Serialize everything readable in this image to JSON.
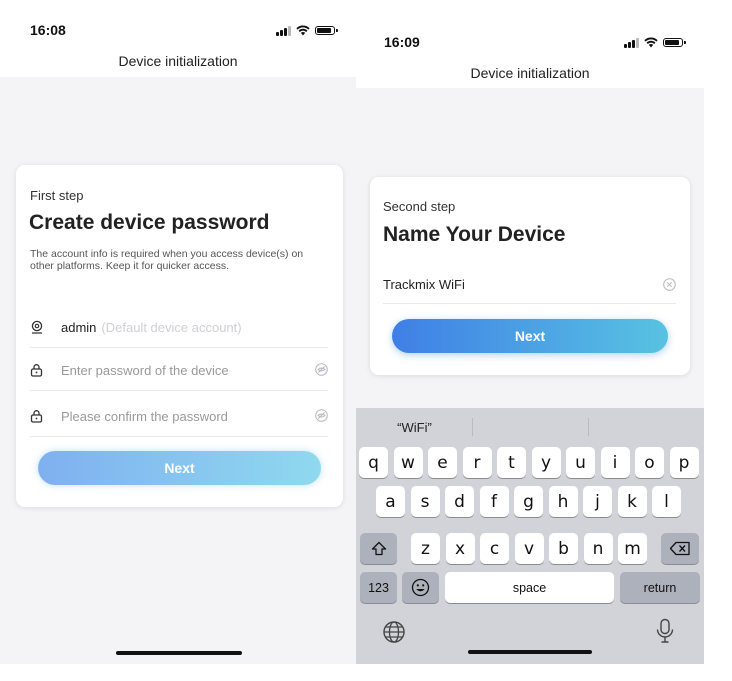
{
  "left": {
    "status_time": "16:08",
    "nav_title": "Device initialization",
    "step_label": "First step",
    "headline": "Create device password",
    "description": "The account info is required when you access device(s) on other platforms. Keep it for quicker access.",
    "account_value": "admin",
    "account_hint": "(Default device account)",
    "password_placeholder": "Enter password of the device",
    "confirm_placeholder": "Please confirm the password",
    "next_label": "Next"
  },
  "right": {
    "status_time": "16:09",
    "nav_title": "Device initialization",
    "step_label": "Second step",
    "headline": "Name Your Device",
    "name_value": "Trackmix WiFi",
    "next_label": "Next",
    "keyboard": {
      "suggestion": "“WiFi”",
      "row1": [
        "q",
        "w",
        "e",
        "r",
        "t",
        "y",
        "u",
        "i",
        "o",
        "p"
      ],
      "row2": [
        "a",
        "s",
        "d",
        "f",
        "g",
        "h",
        "j",
        "k",
        "l"
      ],
      "row3": [
        "z",
        "x",
        "c",
        "v",
        "b",
        "n",
        "m"
      ],
      "numbers_label": "123",
      "space_label": "space",
      "return_label": "return"
    }
  },
  "colors": {
    "screen_bg": "#f4f4f6",
    "card_bg": "#ffffff",
    "left_button_gradient": [
      "#7fb0f0",
      "#8fd9ef"
    ],
    "right_button_gradient": [
      "#3f7fe6",
      "#58c3e2"
    ],
    "keyboard_bg": "#d1d3d9"
  },
  "icons": [
    "signal-icon",
    "wifi-icon",
    "battery-icon",
    "user-icon",
    "lock-icon",
    "eye-off-icon",
    "clear-icon",
    "shift-icon",
    "backspace-icon",
    "emoji-icon",
    "globe-icon",
    "microphone-icon"
  ]
}
